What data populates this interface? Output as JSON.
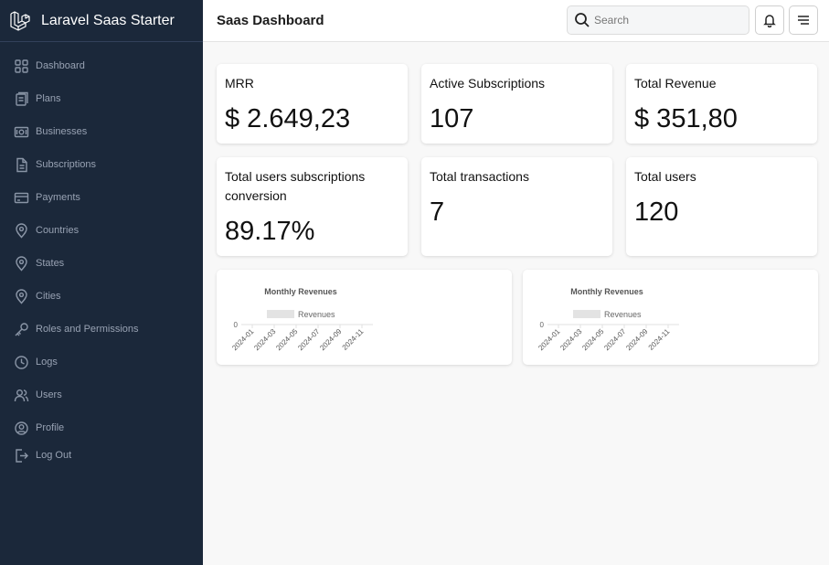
{
  "brand": {
    "name": "Laravel Saas Starter",
    "icon": "laravel-logo-icon"
  },
  "sidebar": {
    "items": [
      {
        "label": "Dashboard",
        "icon": "dashboard-icon"
      },
      {
        "label": "Plans",
        "icon": "plans-icon"
      },
      {
        "label": "Businesses",
        "icon": "businesses-icon"
      },
      {
        "label": "Subscriptions",
        "icon": "subscriptions-icon"
      },
      {
        "label": "Payments",
        "icon": "payments-icon"
      },
      {
        "label": "Countries",
        "icon": "location-pin-icon"
      },
      {
        "label": "States",
        "icon": "location-pin-icon"
      },
      {
        "label": "Cities",
        "icon": "location-pin-icon"
      },
      {
        "label": "Roles and Permissions",
        "icon": "key-icon"
      },
      {
        "label": "Logs",
        "icon": "clock-icon"
      },
      {
        "label": "Users",
        "icon": "users-icon"
      },
      {
        "label": "Profile",
        "icon": "profile-icon"
      },
      {
        "label": "Log Out",
        "icon": "logout-icon"
      }
    ]
  },
  "header": {
    "title": "Saas Dashboard",
    "search_placeholder": "Search",
    "search_value": ""
  },
  "stats": [
    {
      "label": "MRR",
      "value": "$ 2.649,23"
    },
    {
      "label": "Active Subscriptions",
      "value": "107"
    },
    {
      "label": "Total Revenue",
      "value": "$ 351,80"
    },
    {
      "label": "Total users subscriptions conversion",
      "value": "89.17%"
    },
    {
      "label": "Total transactions",
      "value": "7"
    },
    {
      "label": "Total users",
      "value": "120"
    }
  ],
  "colors": {
    "sidebar_bg": "#1b283a",
    "page_bg": "#f8f8f8",
    "legend_swatch": "#e3e3e3"
  },
  "chart_data": [
    {
      "type": "bar",
      "title": "Monthly Revenues",
      "categories": [
        "2024-01",
        "2024-03",
        "2024-05",
        "2024-07",
        "2024-09",
        "2024-11"
      ],
      "series": [
        {
          "name": "Revenues",
          "values": [
            0,
            0,
            0,
            0,
            0,
            0
          ]
        }
      ],
      "ytick_labels": [
        "0"
      ],
      "xlabel": "",
      "ylabel": "",
      "legend": "top"
    },
    {
      "type": "bar",
      "title": "Monthly Revenues",
      "categories": [
        "2024-01",
        "2024-03",
        "2024-05",
        "2024-07",
        "2024-09",
        "2024-11"
      ],
      "series": [
        {
          "name": "Revenues",
          "values": [
            0,
            0,
            0,
            0,
            0,
            0
          ]
        }
      ],
      "ytick_labels": [
        "0"
      ],
      "xlabel": "",
      "ylabel": "",
      "legend": "top"
    }
  ]
}
